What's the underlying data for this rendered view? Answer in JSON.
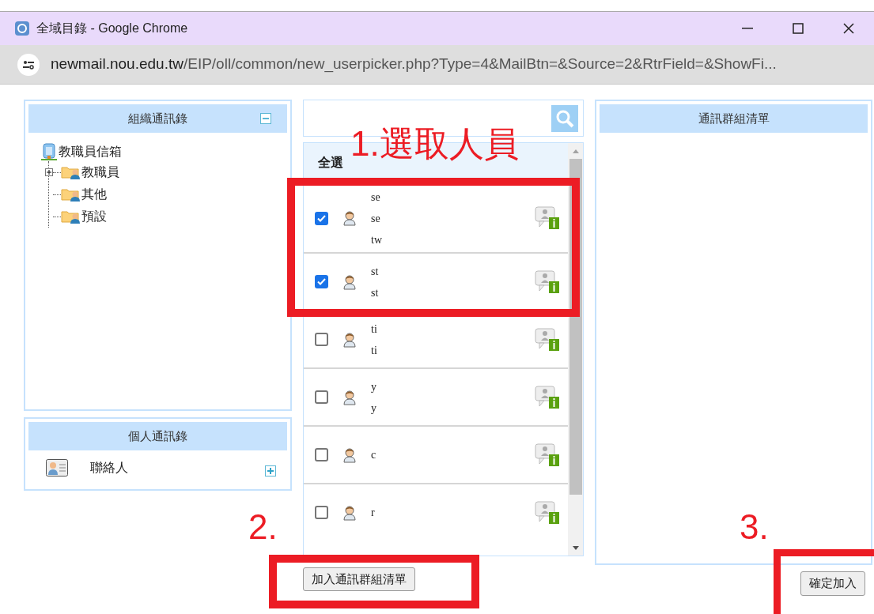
{
  "window": {
    "title": "全域目錄 - Google Chrome"
  },
  "address_bar": {
    "host": "newmail.nou.edu.tw",
    "path": "/EIP/oll/common/new_userpicker.php?Type=4&MailBtn=&Source=2&RtrField=&ShowFi..."
  },
  "org_panel": {
    "title": "組織通訊錄",
    "expanded": true,
    "tree": [
      {
        "label": "教職員信箱",
        "children": [
          {
            "label": "教職員",
            "collapsed": true
          },
          {
            "label": "其他",
            "collapsed": false
          },
          {
            "label": "預設",
            "collapsed": false
          }
        ]
      }
    ]
  },
  "personal_panel": {
    "title": "個人通訊錄",
    "items": [
      {
        "label": "聯絡人"
      }
    ]
  },
  "member_list": {
    "select_all": "全選",
    "rows": [
      {
        "checked": true,
        "lines": [
          "se",
          "se",
          "tw"
        ]
      },
      {
        "checked": true,
        "lines": [
          "st",
          "st"
        ]
      },
      {
        "checked": false,
        "lines": [
          "ti",
          "ti"
        ]
      },
      {
        "checked": false,
        "lines": [
          "y",
          "y"
        ]
      },
      {
        "checked": false,
        "lines": [
          "c"
        ]
      },
      {
        "checked": false,
        "lines": [
          "r"
        ]
      }
    ]
  },
  "group_panel": {
    "title": "通訊群組清單"
  },
  "buttons": {
    "add": "加入通訊群組清單",
    "confirm": "確定加入"
  },
  "annotations": [
    {
      "label": "1.選取人員"
    },
    {
      "label": "2."
    },
    {
      "label": "3."
    }
  ]
}
